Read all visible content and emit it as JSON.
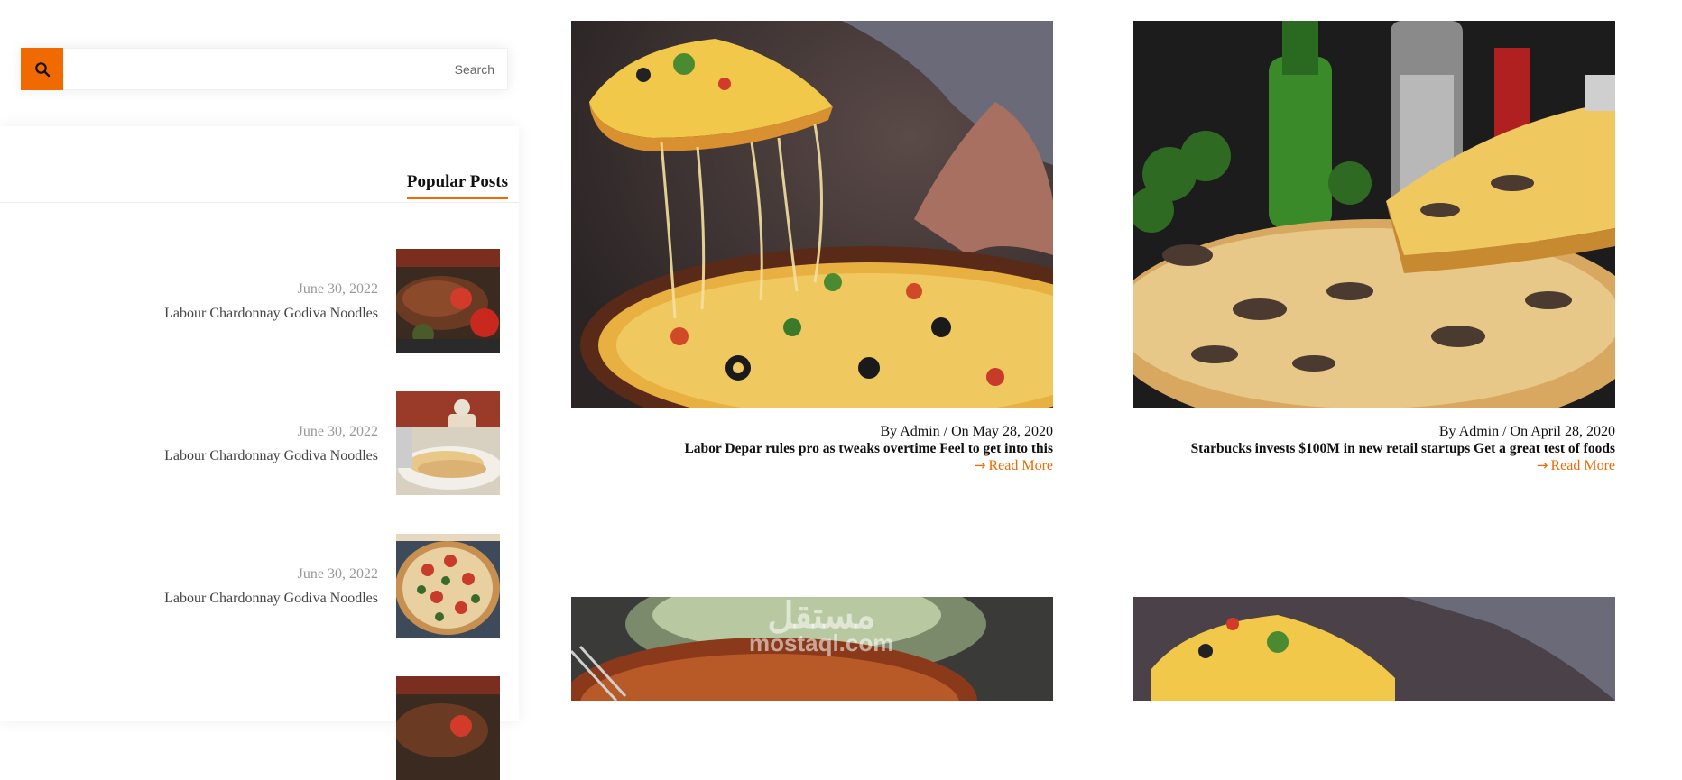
{
  "search": {
    "placeholder": "Search",
    "icon": "search-icon"
  },
  "sidebar": {
    "popular_title": "Popular Posts",
    "posts": [
      {
        "date": "June 30, 2022",
        "title": "Labour Chardonnay Godiva Noodles"
      },
      {
        "date": "June 30, 2022",
        "title": "Labour Chardonnay Godiva Noodles"
      },
      {
        "date": "June 30, 2022",
        "title": "Labour Chardonnay Godiva Noodles"
      },
      {
        "date": "",
        "title": ""
      }
    ]
  },
  "articles": [
    {
      "meta": "By Admin / On May 28, 2020",
      "title": "Labor Depar rules pro as tweaks overtime Feel to get into this",
      "read_more": "Read More"
    },
    {
      "meta": "By Admin / On April 28, 2020",
      "title": "Starbucks invests $100M in new retail startups Get a great test of foods",
      "read_more": "Read More"
    },
    {
      "meta": "",
      "title": "",
      "read_more": ""
    },
    {
      "meta": "",
      "title": "",
      "read_more": ""
    }
  ],
  "watermark": {
    "arabic": "مستقل",
    "latin": "mostaql.com"
  },
  "colors": {
    "accent": "#f06a00"
  }
}
